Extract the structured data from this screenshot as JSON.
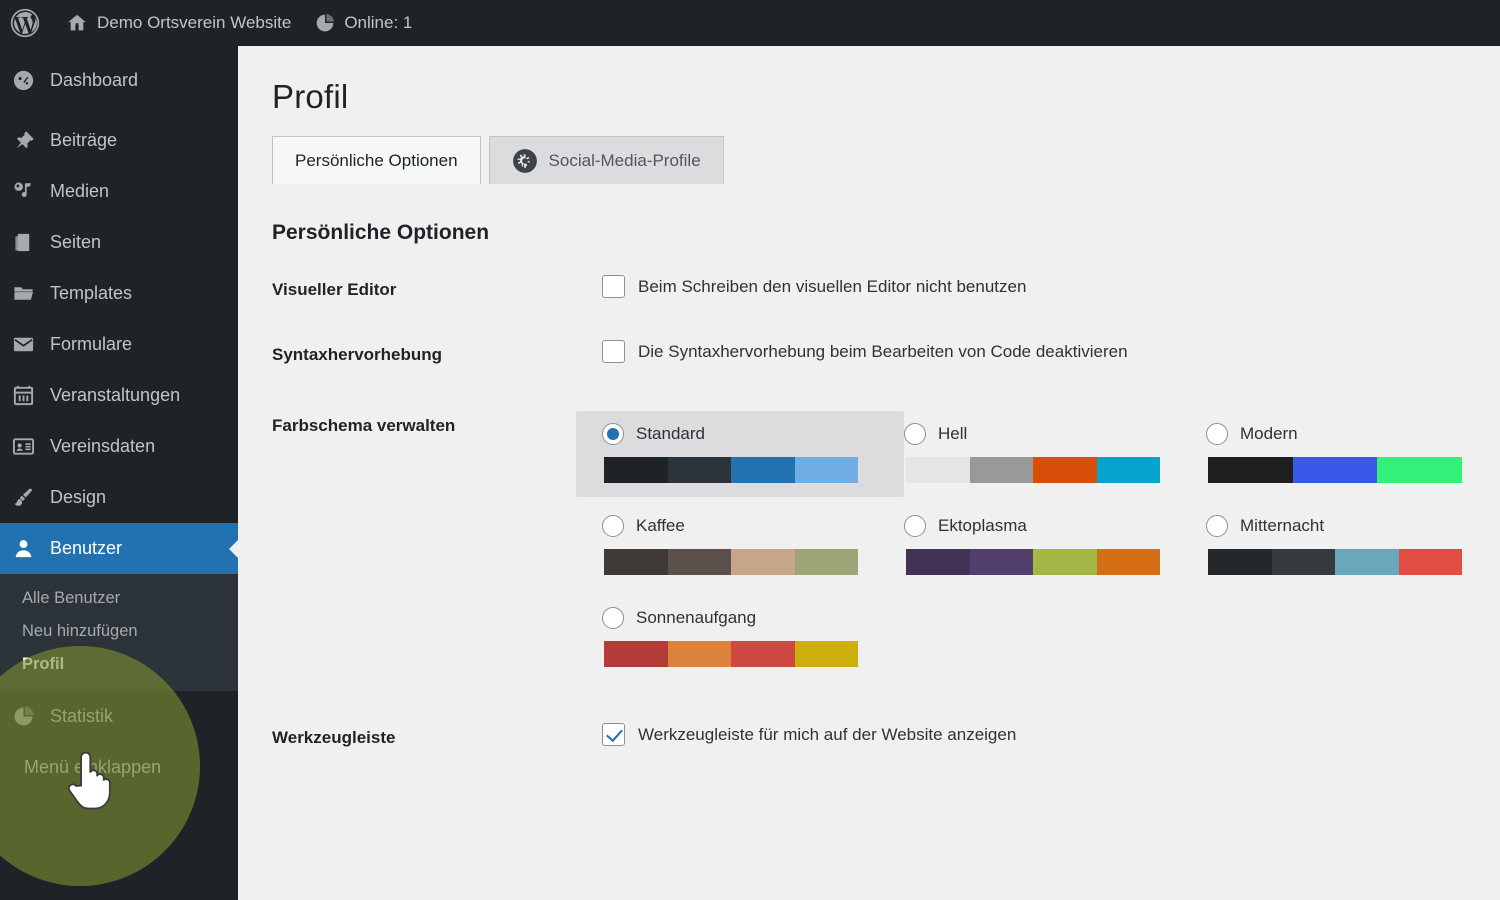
{
  "adminbar": {
    "logo_icon": "wordpress-logo-icon",
    "site_icon": "home-icon",
    "site_name": "Demo Ortsverein Website",
    "online_icon": "pie-chart-icon",
    "online_label": "Online: 1"
  },
  "sidebar": {
    "items": [
      {
        "label": "Dashboard",
        "icon": "dashboard-icon"
      },
      {
        "label": "Beiträge",
        "icon": "pin-icon"
      },
      {
        "label": "Medien",
        "icon": "media-icon"
      },
      {
        "label": "Seiten",
        "icon": "pages-icon"
      },
      {
        "label": "Templates",
        "icon": "folder-icon"
      },
      {
        "label": "Formulare",
        "icon": "envelope-icon"
      },
      {
        "label": "Veranstaltungen",
        "icon": "calendar-icon"
      },
      {
        "label": "Vereinsdaten",
        "icon": "id-card-icon"
      },
      {
        "label": "Design",
        "icon": "paintbrush-icon"
      },
      {
        "label": "Benutzer",
        "icon": "user-icon"
      }
    ],
    "submenu": [
      {
        "label": "Alle Benutzer",
        "current": false
      },
      {
        "label": "Neu hinzufügen",
        "current": false
      },
      {
        "label": "Profil",
        "current": true
      }
    ],
    "statistik": {
      "label": "Statistik",
      "icon": "pie-chart-icon"
    },
    "collapse": {
      "label": "Menü einklappen",
      "icon": "collapse-arrow-icon"
    },
    "active_item": "Benutzer",
    "highlight_color": "#7d9032",
    "accent_color": "#2271b1",
    "background_color": "#1d2327",
    "submenu_background_color": "#2c3338"
  },
  "page": {
    "title": "Profil",
    "tabs": [
      {
        "label": "Persönliche Optionen",
        "active": true,
        "icon": null
      },
      {
        "label": "Social-Media-Profile",
        "active": false,
        "icon": "gear-plug-icon"
      }
    ],
    "section_title": "Persönliche Optionen"
  },
  "form": {
    "visual_editor": {
      "label": "Visueller Editor",
      "checkbox_label": "Beim Schreiben den visuellen Editor nicht benutzen",
      "checked": false
    },
    "syntax_highlighting": {
      "label": "Syntaxhervorhebung",
      "checkbox_label": "Die Syntaxhervorhebung beim Bearbeiten von Code deaktivieren",
      "checked": false
    },
    "color_scheme": {
      "label": "Farbschema verwalten",
      "selected": "Standard",
      "options": [
        {
          "name": "Standard",
          "selected": true,
          "colors": [
            "#1d2327",
            "#2c3338",
            "#2271b1",
            "#72aee6"
          ]
        },
        {
          "name": "Hell",
          "selected": false,
          "colors": [
            "#e5e5e5",
            "#999999",
            "#d64e07",
            "#04a4cc"
          ]
        },
        {
          "name": "Modern",
          "selected": false,
          "colors": [
            "#1e1e1e",
            "#3858e9",
            "#33f078"
          ]
        },
        {
          "name": "Kaffee",
          "selected": false,
          "colors": [
            "#3f3a38",
            "#5b504a",
            "#c7a589",
            "#9ea476"
          ]
        },
        {
          "name": "Ektoplasma",
          "selected": false,
          "colors": [
            "#413256",
            "#523f6d",
            "#a3b745",
            "#d46f15"
          ]
        },
        {
          "name": "Mitternacht",
          "selected": false,
          "colors": [
            "#25282b",
            "#363b3f",
            "#69a8bb",
            "#e14d43"
          ]
        },
        {
          "name": "Sonnenaufgang",
          "selected": false,
          "colors": [
            "#b43c38",
            "#dd823b",
            "#cf4944",
            "#ccaf0b"
          ]
        }
      ]
    },
    "toolbar": {
      "label": "Werkzeugleiste",
      "checkbox_label": "Werkzeugleiste für mich auf der Website anzeigen",
      "checked": true
    }
  }
}
